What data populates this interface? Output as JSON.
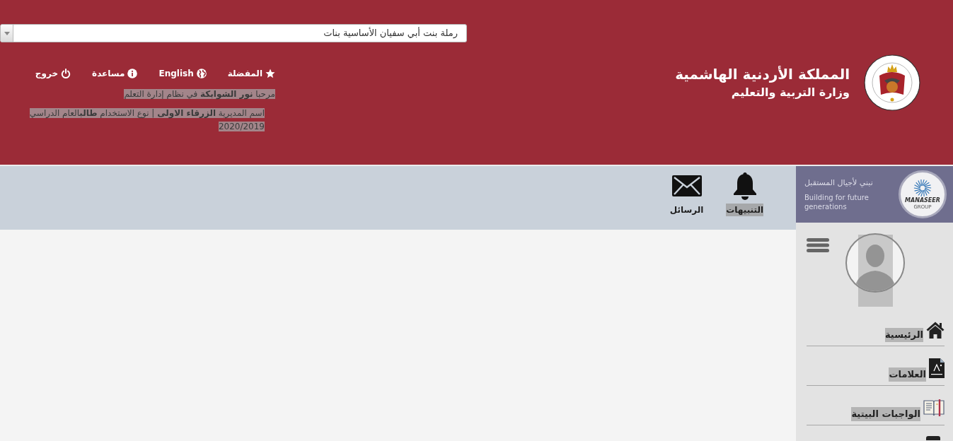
{
  "school_select": {
    "value": "رملة بنت أبي سفيان الأساسية بنات"
  },
  "header": {
    "title": "المملكة الأردنية الهاشمية",
    "subtitle": "وزارة التربية والتعليم"
  },
  "top_links": [
    {
      "kind": "favorites",
      "label": "المفضلة"
    },
    {
      "kind": "language",
      "label": "English"
    },
    {
      "kind": "help",
      "label": "مساعدة"
    },
    {
      "kind": "logout",
      "label": "خروج"
    }
  ],
  "user_info": [
    {
      "kind": "welcome",
      "text": "مرحبا **نور الشوابكة** في نظام إدارة التعلم",
      "highlighted": true
    },
    {
      "kind": "details",
      "text": "اسم المديرية **الزرقاء الاولى** | نوع الاستخدام **طالب**العام الدراسي 2020/2019",
      "highlighted": true
    }
  ],
  "toolbar": [
    {
      "kind": "alerts",
      "label": "التنبيهات",
      "highlighted": true
    },
    {
      "kind": "messages",
      "label": "الرسائل",
      "highlighted": false
    }
  ],
  "sidebar": {
    "banner": {
      "tagline_ar": "نبني لأجيال المستقبل",
      "tagline_en": "Building for future generations",
      "logo_name": "MANASEER",
      "logo_group": "GROUP"
    },
    "avatar": {
      "highlighted": true
    },
    "items": [
      {
        "kind": "home",
        "label": "الرئيسية",
        "highlighted": true
      },
      {
        "kind": "grades",
        "label": "العلامات",
        "highlighted": true
      },
      {
        "kind": "homework",
        "label": "الواجبات البيتية",
        "highlighted": true
      }
    ]
  }
}
